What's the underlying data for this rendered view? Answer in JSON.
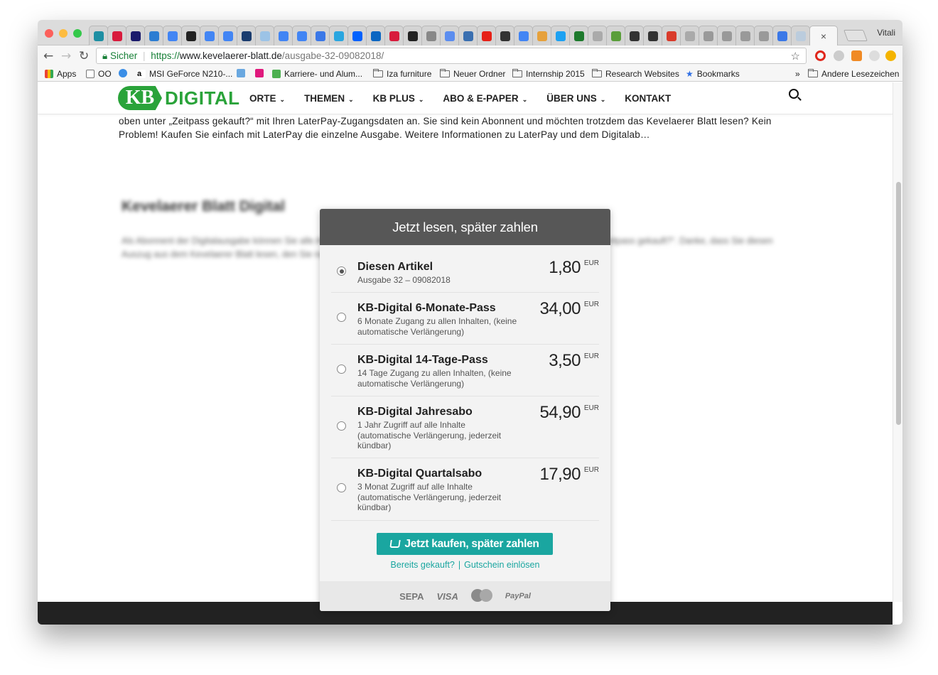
{
  "browser": {
    "profile_name": "Vitali",
    "tab_close": "×",
    "address": {
      "secure_label": "Sicher",
      "scheme": "https://",
      "host": "www.kevelaerer-blatt.de",
      "path": "/ausgabe-32-09082018/"
    },
    "bookmarks": [
      "Apps",
      "OO",
      "MSI GeForce N210-...",
      "Karriere- und Alum...",
      "Iza furniture",
      "Neuer Ordner",
      "Internship 2015",
      "Research Websites",
      "Bookmarks",
      "Andere Lesezeichen"
    ],
    "bookmarks_overflow": "»"
  },
  "site": {
    "logo_kb": "KB",
    "logo_word": "DIGITAL",
    "menu": [
      "ORTE",
      "THEMEN",
      "KB PLUS",
      "ABO & E-PAPER",
      "ÜBER UNS",
      "KONTAKT"
    ],
    "intro_text": "oben unter „Zeitpass gekauft?“ mit Ihren LaterPay-Zugangsdaten an. Sie sind kein Abonnent und möchten trotzdem das Kevelaerer Blatt lesen? Kein Problem! Kaufen Sie einfach mit LaterPay die einzelne Ausgabe. Weitere Informationen zu LaterPay und dem Digitalab…",
    "blurred_title": "Kevelaerer Blatt Digital",
    "blurred_text": "Als Abonnent der Digitalausgabe können Sie alle Artikel kostenlos lesen. Melden Sie sich dazu einfach rechts oben unter „Zeitpass gekauft?“. Danke, dass Sie diesen Auszug aus dem Kevelaerer Blatt lesen, den Sie nun gegen einen geringen Betrag lesen, nachdem Sie ihn gekauft haben."
  },
  "dialog": {
    "title": "Jetzt lesen, später zahlen",
    "options": [
      {
        "title": "Diesen Artikel",
        "description": "Ausgabe 32 – 09082018",
        "price": "1,80",
        "currency": "EUR",
        "selected": true
      },
      {
        "title": "KB-Digital 6-Monate-Pass",
        "description": "6 Monate Zugang zu allen Inhalten, (keine automatische Verlängerung)",
        "price": "34,00",
        "currency": "EUR",
        "selected": false
      },
      {
        "title": "KB-Digital 14-Tage-Pass",
        "description": "14 Tage Zugang zu allen Inhalten, (keine automatische Verlängerung)",
        "price": "3,50",
        "currency": "EUR",
        "selected": false
      },
      {
        "title": "KB-Digital Jahresabo",
        "description": "1 Jahr Zugriff auf alle Inhalte (automatische Verlängerung, jederzeit kündbar)",
        "price": "54,90",
        "currency": "EUR",
        "selected": false
      },
      {
        "title": "KB-Digital Quartalsabo",
        "description": "3 Monat Zugriff auf alle Inhalte (automatische Verlängerung, jederzeit kündbar)",
        "price": "17,90",
        "currency": "EUR",
        "selected": false
      }
    ],
    "buy_button": "Jetzt kaufen, später zahlen",
    "already_bought": "Bereits gekauft?",
    "link_separator": "|",
    "redeem_voucher": "Gutschein einlösen",
    "payment_methods": [
      "SEPA",
      "VISA",
      "mastercard",
      "PayPal"
    ]
  },
  "colors": {
    "brand_green": "#2aa33a",
    "accent_teal": "#1aa6a0",
    "dialog_header": "#575757"
  }
}
